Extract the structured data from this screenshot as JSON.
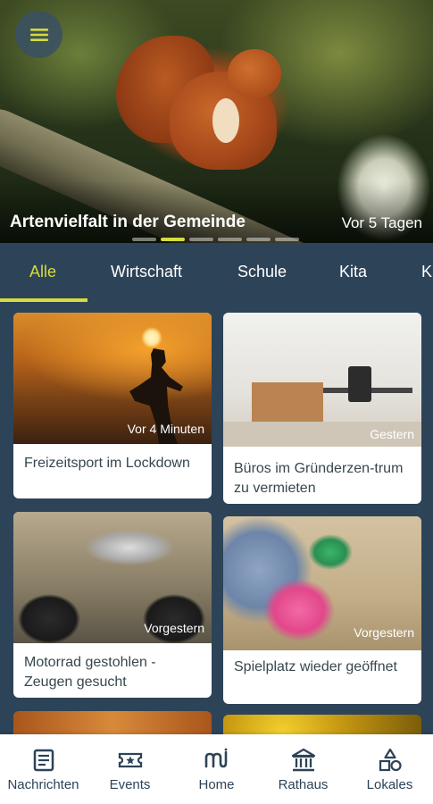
{
  "hero": {
    "title": "Artenvielfalt in der Gemeinde",
    "time": "Vor 5 Tagen",
    "slides": 6,
    "active_slide": 2
  },
  "tabs": [
    {
      "label": "Alle",
      "active": true
    },
    {
      "label": "Wirtschaft"
    },
    {
      "label": "Schule"
    },
    {
      "label": "Kita"
    },
    {
      "label": "K"
    }
  ],
  "cards": [
    {
      "time": "Vor 4 Minuten",
      "title": "Freizeitsport im Lockdown"
    },
    {
      "time": "Gestern",
      "title": "Büros im Gründerzen-trum zu vermieten"
    },
    {
      "time": "Vorgestern",
      "title": "Motorrad gestohlen - Zeugen gesucht"
    },
    {
      "time": "Vorgestern",
      "title": "Spielplatz wieder geöffnet"
    }
  ],
  "nav": [
    {
      "label": "Nachrichten",
      "icon": "news-icon",
      "active": true
    },
    {
      "label": "Events",
      "icon": "ticket-star-icon"
    },
    {
      "label": "Home",
      "icon": "home-logo-icon"
    },
    {
      "label": "Rathaus",
      "icon": "town-hall-icon"
    },
    {
      "label": "Lokales",
      "icon": "shapes-icon"
    }
  ],
  "colors": {
    "primary": "#2d4358",
    "accent": "#d6dc3b",
    "card_text": "#37474f"
  }
}
